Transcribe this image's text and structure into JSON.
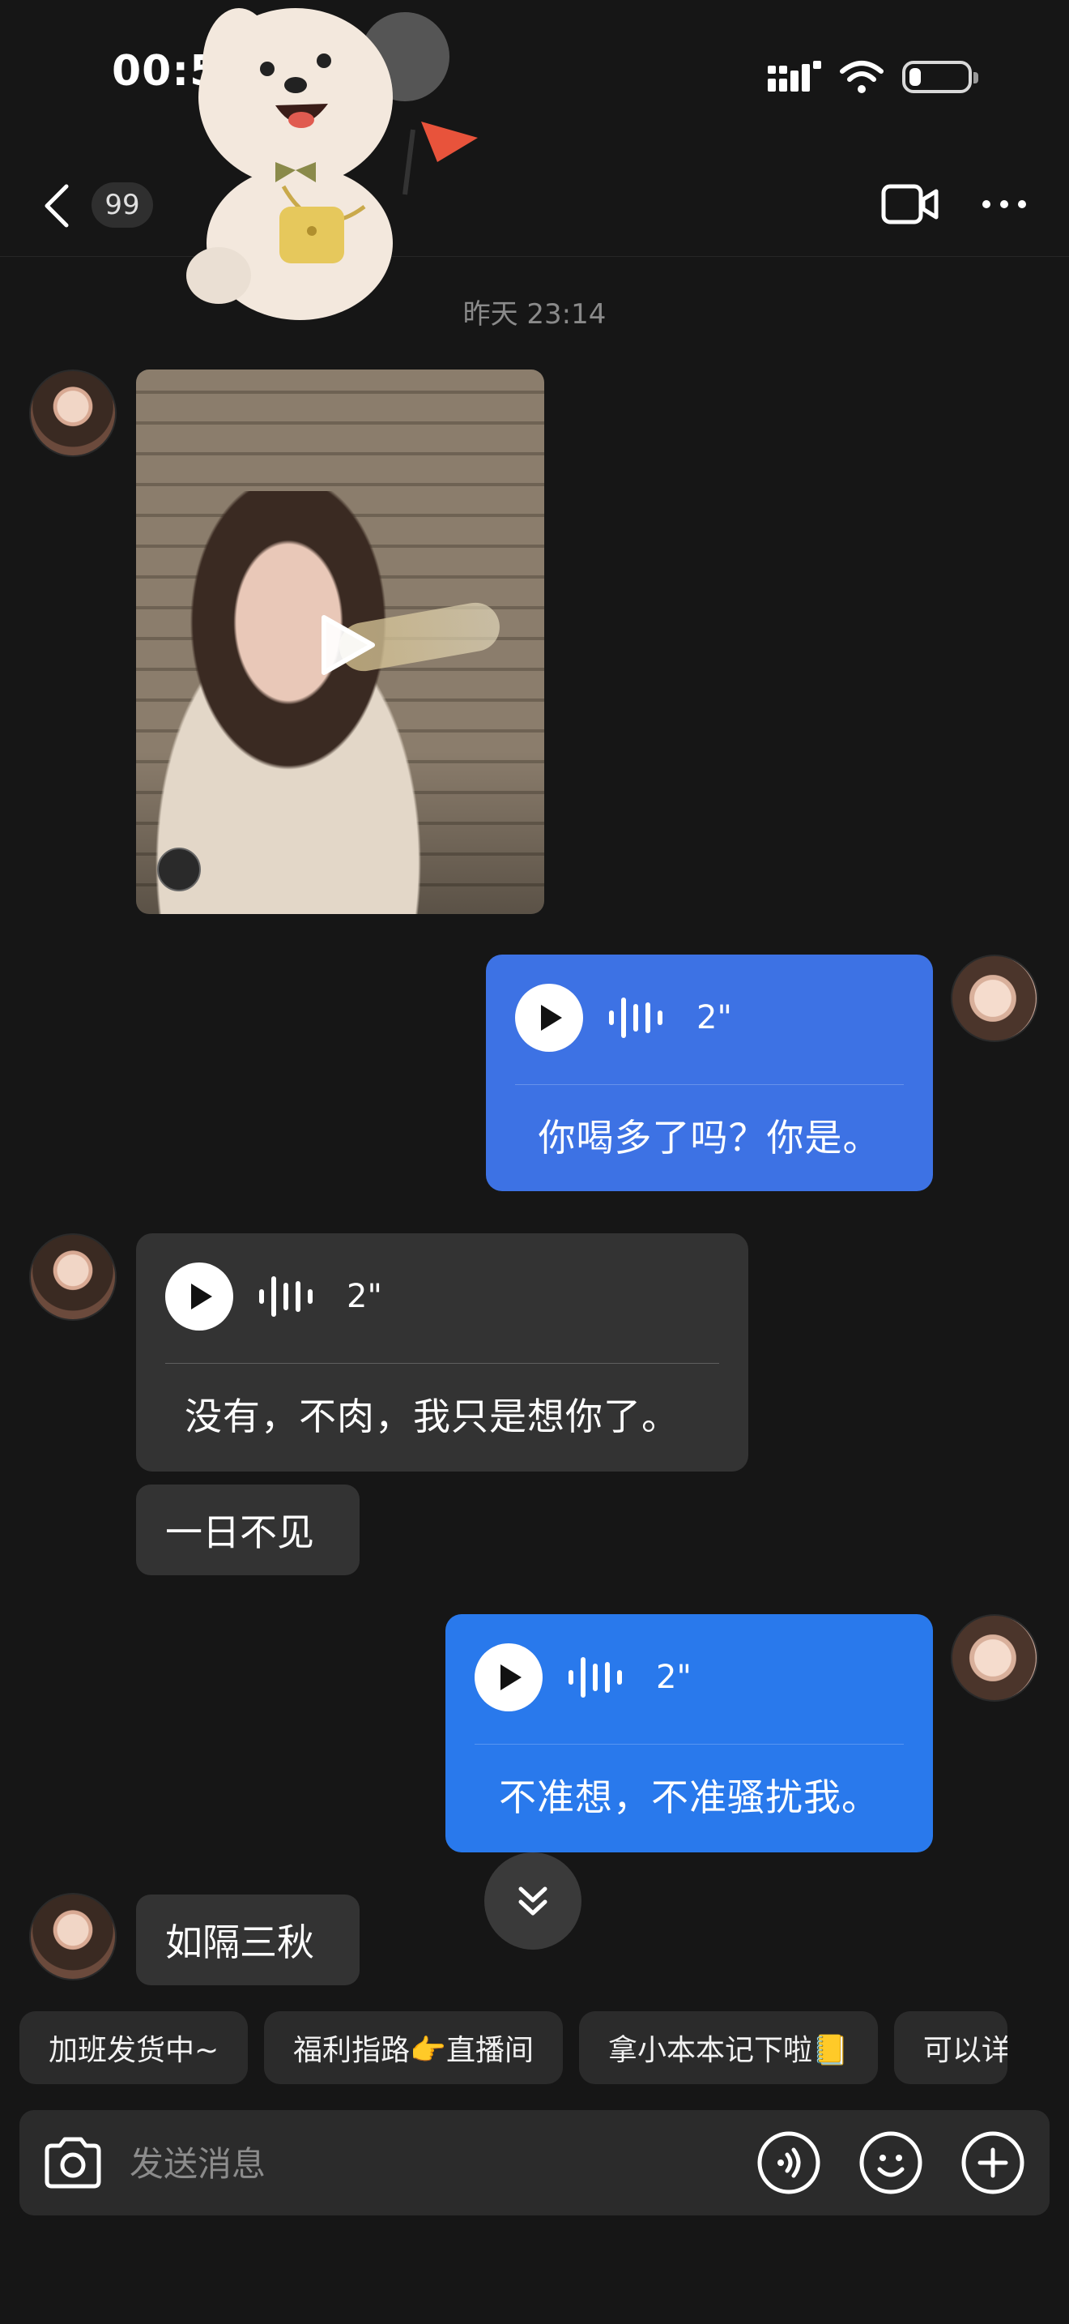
{
  "status_bar": {
    "time": "00:5",
    "battery_level": 0.2
  },
  "header": {
    "unread_count": "99",
    "icons": [
      "back-arrow-icon",
      "video-call-icon",
      "more-icon"
    ]
  },
  "chat": {
    "timestamp": "昨天 23:14",
    "messages": [
      {
        "type": "video",
        "sender": "other"
      },
      {
        "type": "voice",
        "sender": "self",
        "duration": "2\"",
        "transcript": "你喝多了吗？你是。"
      },
      {
        "type": "voice",
        "sender": "other",
        "duration": "2\"",
        "transcript": "没有，不肉，我只是想你了。"
      },
      {
        "type": "text",
        "sender": "other",
        "text": "一日不见"
      },
      {
        "type": "voice",
        "sender": "self",
        "duration": "2\"",
        "transcript": "不准想，不准骚扰我。"
      },
      {
        "type": "text",
        "sender": "other",
        "text": "如隔三秋"
      }
    ]
  },
  "quick_replies": [
    "加班发货中~",
    "福利指路👉直播间",
    "拿小本本记下啦📒",
    "可以详"
  ],
  "input": {
    "placeholder": "发送消息",
    "icons": [
      "camera-icon",
      "voice-input-icon",
      "emoji-icon",
      "add-icon"
    ]
  },
  "colors": {
    "background": "#161616",
    "self_bubble": "#3d72e4",
    "other_bubble": "#333333"
  }
}
